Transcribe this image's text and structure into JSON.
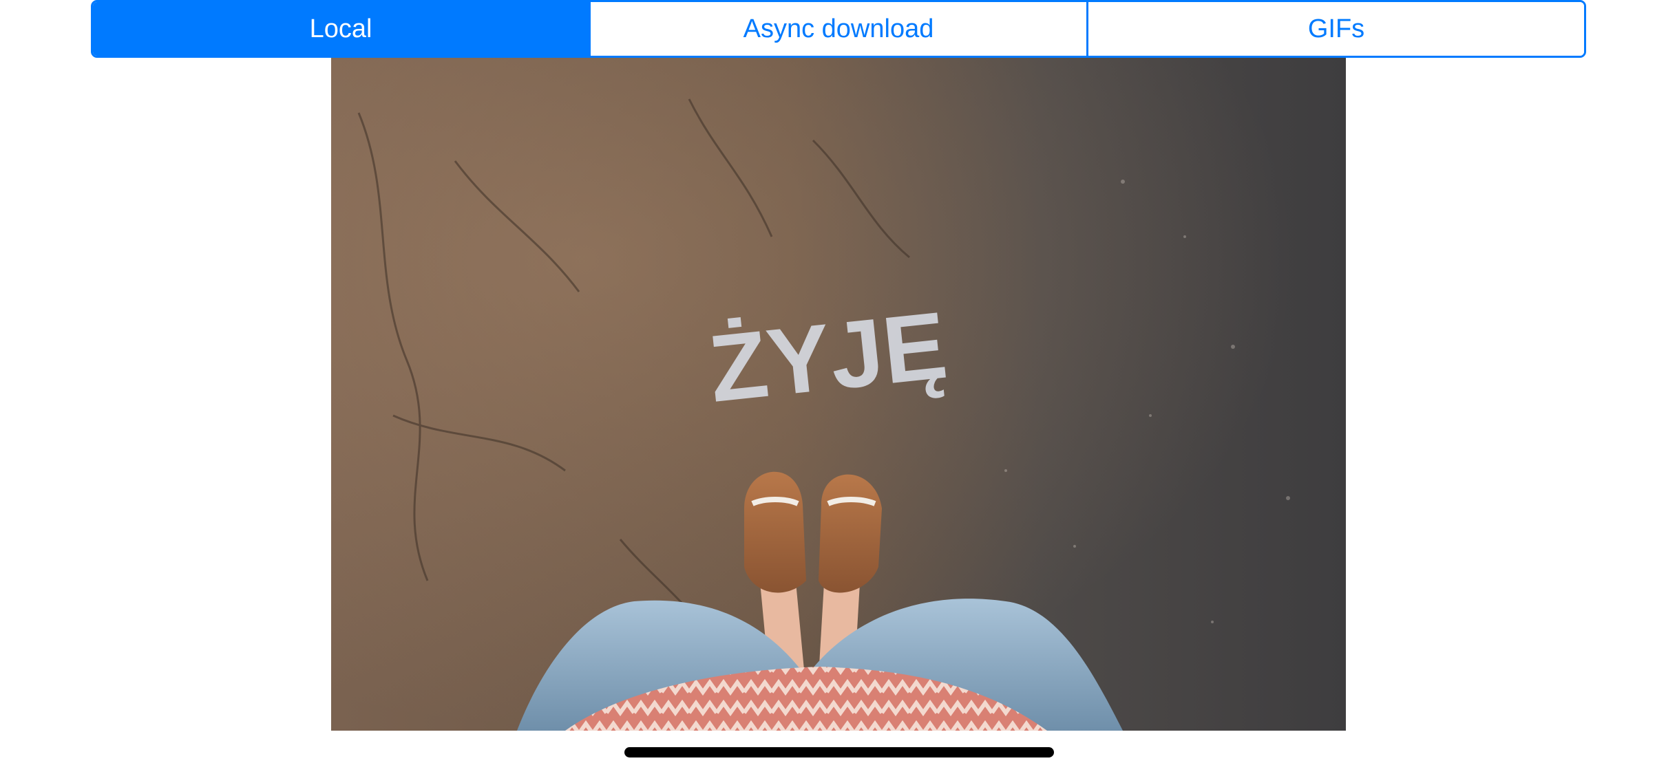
{
  "colors": {
    "accent": "#007aff"
  },
  "segmented_control": {
    "selected_index": 0,
    "items": [
      {
        "label": "Local"
      },
      {
        "label": "Async download"
      },
      {
        "label": "GIFs"
      }
    ]
  },
  "image": {
    "icon": "photo-image",
    "painted_text": "ŻYJĘ"
  }
}
